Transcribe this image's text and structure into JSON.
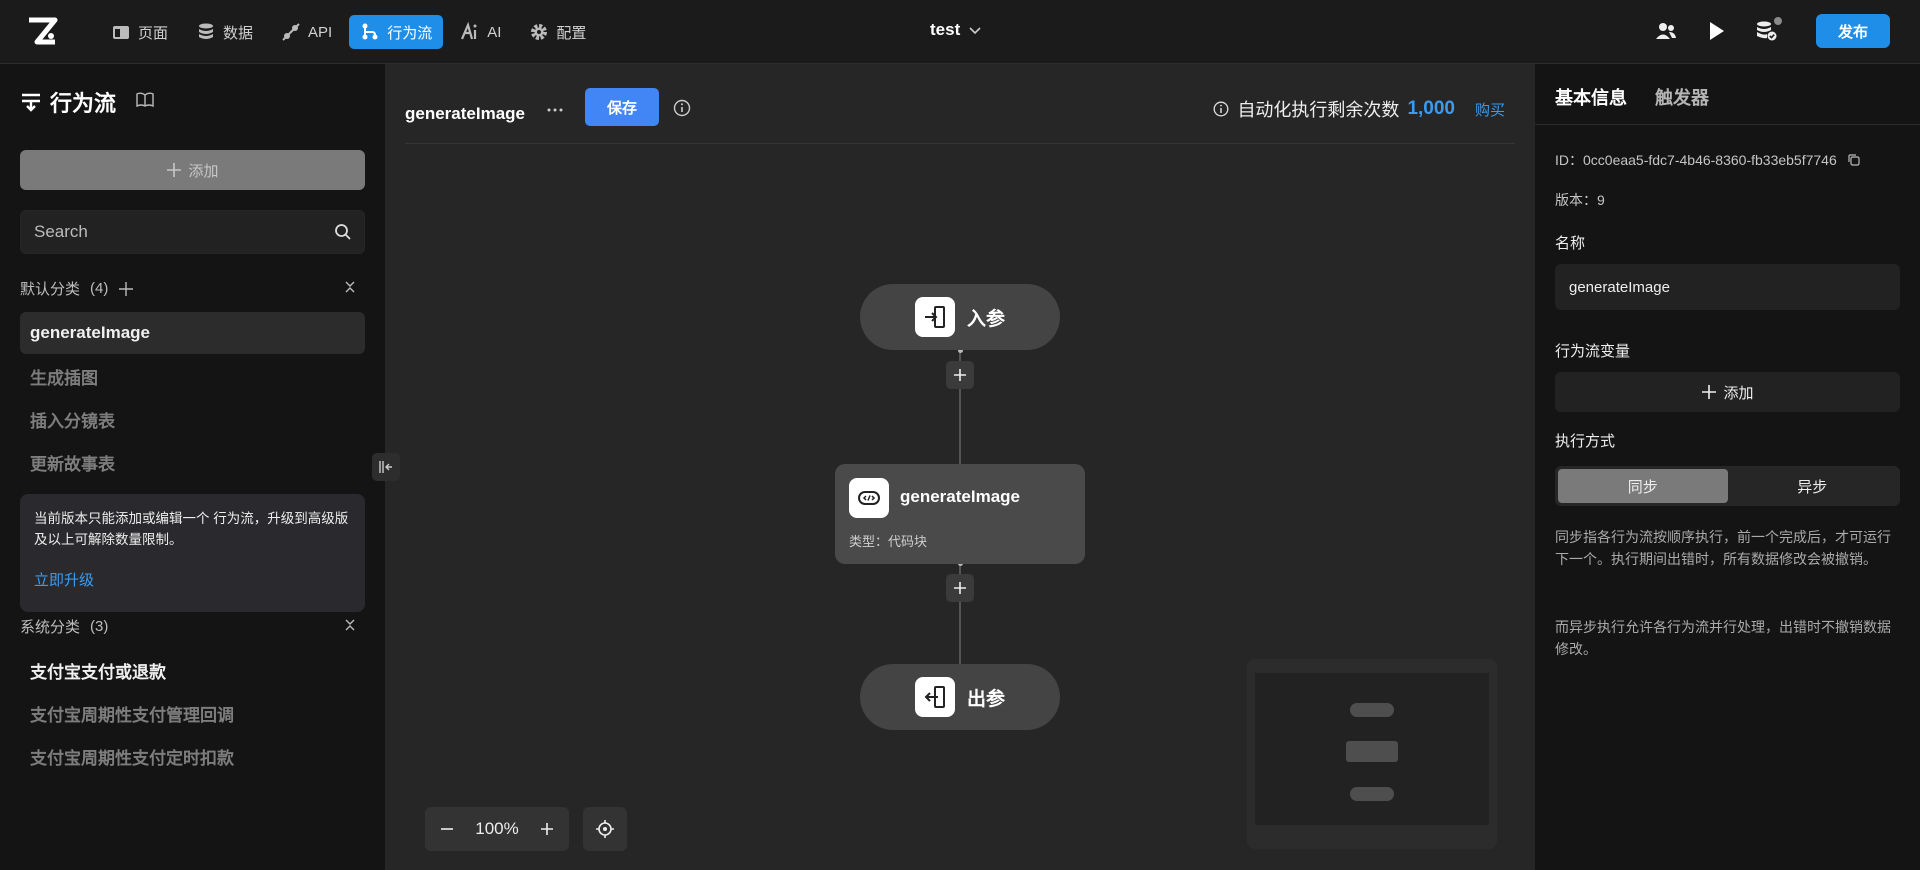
{
  "nav": {
    "tabs": [
      {
        "label": "页面",
        "icon": "page-icon"
      },
      {
        "label": "数据",
        "icon": "database-icon"
      },
      {
        "label": "API",
        "icon": "api-icon"
      },
      {
        "label": "行为流",
        "icon": "flow-icon",
        "active": true
      },
      {
        "label": "AI",
        "icon": "ai-icon"
      },
      {
        "label": "配置",
        "icon": "gear-icon"
      }
    ],
    "project": "test",
    "publish_label": "发布"
  },
  "sidebar": {
    "title": "行为流",
    "add_label": "添加",
    "search_placeholder": "Search",
    "default_group": {
      "label": "默认分类",
      "count": "(4)"
    },
    "default_items": [
      "generateImage",
      "生成插图",
      "插入分镜表",
      "更新故事表"
    ],
    "notice_text": "当前版本只能添加或编辑一个 行为流，升级到高级版及以上可解除数量限制。",
    "upgrade_label": "立即升级",
    "system_group": {
      "label": "系统分类",
      "count": "(3)"
    },
    "system_items": [
      "支付宝支付或退款",
      "支付宝周期性支付管理回调",
      "支付宝周期性支付定时扣款"
    ]
  },
  "canvas": {
    "flow_name": "generateImage",
    "save_label": "保存",
    "quota_label": "自动化执行剩余次数",
    "quota_value": "1,000",
    "buy_label": "购买",
    "input_node": "入参",
    "code_node": {
      "title": "generateImage",
      "type": "类型：代码块"
    },
    "output_node": "出参",
    "zoom": "100%"
  },
  "panel": {
    "tabs": [
      "基本信息",
      "触发器"
    ],
    "id_text": "ID：0cc0eaa5-fdc7-4b46-8360-fb33eb5f7746",
    "version_text": "版本：9",
    "name_label": "名称",
    "name_value": "generateImage",
    "vars_label": "行为流变量",
    "vars_add_label": "添加",
    "exec_label": "执行方式",
    "exec_options": [
      "同步",
      "异步"
    ],
    "sync_desc": "同步指各行为流按顺序执行，前一个完成后，才可运行下一个。执行期间出错时，所有数据修改会被撤销。",
    "async_desc": "而异步执行允许各行为流并行处理，出错时不撤销数据修改。"
  },
  "colors": {
    "accent": "#1f8ee8",
    "save": "#4186f4",
    "link": "#3a9bef"
  }
}
